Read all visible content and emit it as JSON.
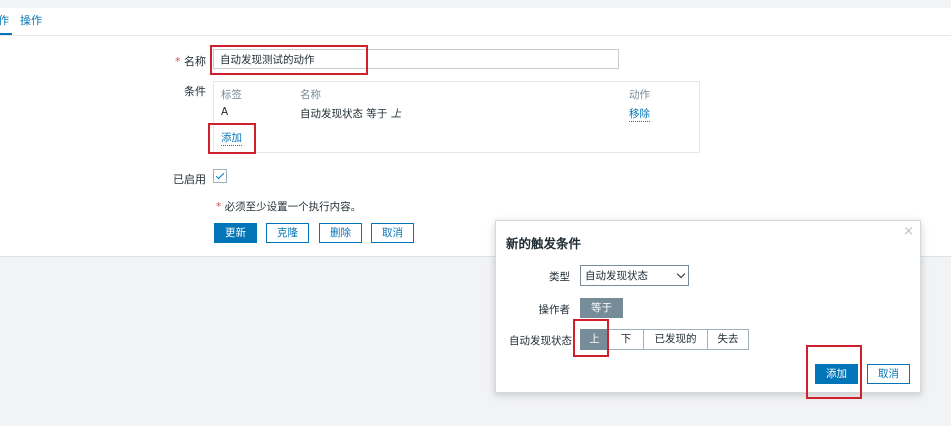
{
  "tabs": {
    "cut_label": "作",
    "ops_label": "操作"
  },
  "form": {
    "name_label": "名称",
    "name_value": "自动发现测试的动作",
    "conditions_label": "条件",
    "conditions": {
      "headers": {
        "tag": "标签",
        "name": "名称",
        "action": "动作"
      },
      "rows": [
        {
          "tag": "A",
          "name_prefix": "自动发现状态 等于 ",
          "name_value": "上",
          "action": "移除"
        }
      ],
      "add_link": "添加"
    },
    "enabled_label": "已启用",
    "notice": "必须至少设置一个执行内容。",
    "buttons": {
      "update": "更新",
      "clone": "克隆",
      "delete": "删除",
      "cancel": "取消"
    }
  },
  "dialog": {
    "title": "新的触发条件",
    "close": "×",
    "type_label": "类型",
    "type_value": "自动发现状态",
    "operator_label": "操作者",
    "operator_value": "等于",
    "status_label": "自动发现状态",
    "status_options": [
      "上",
      "下",
      "已发现的",
      "失去"
    ],
    "status_selected": "上",
    "add_button": "添加",
    "cancel_button": "取消"
  },
  "colors": {
    "accent": "#0275b8",
    "highlight": "#d0202e",
    "segment_active": "#768d99"
  }
}
